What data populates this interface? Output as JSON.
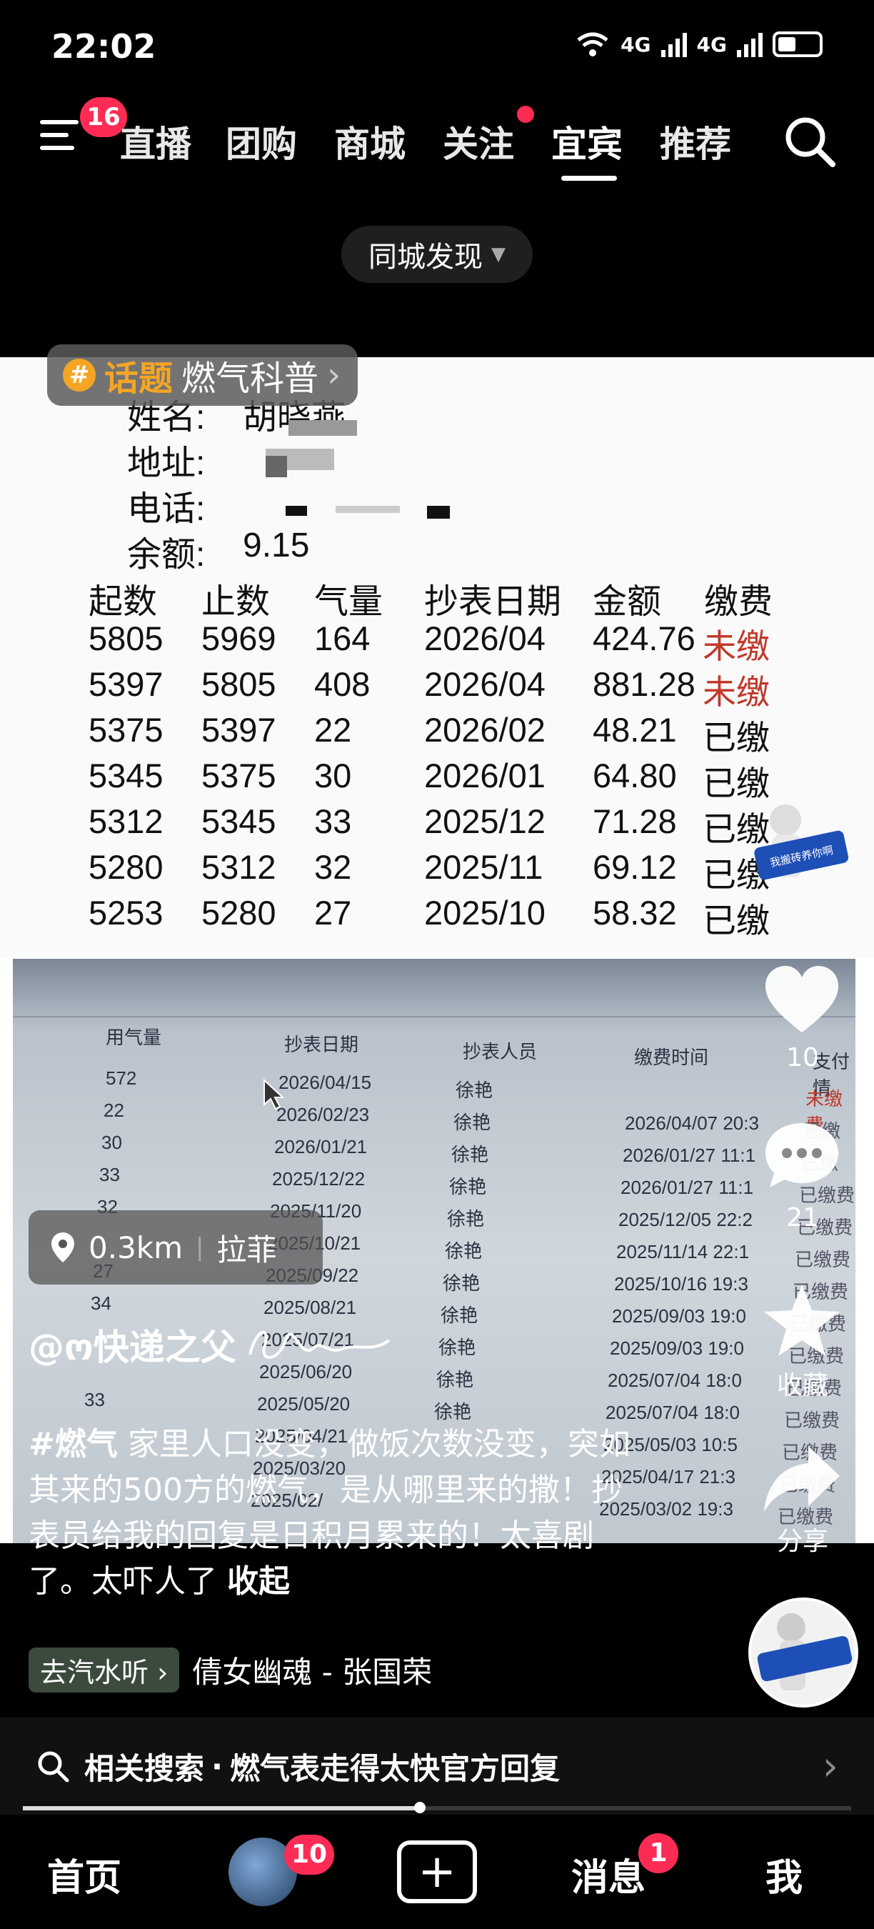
{
  "status_bar": {
    "time": "22:02",
    "network_1": "4G",
    "network_2": "4G"
  },
  "top_nav": {
    "menu_badge": "16",
    "tabs": [
      {
        "label": "直播",
        "active": false
      },
      {
        "label": "团购",
        "active": false
      },
      {
        "label": "商城",
        "active": false
      },
      {
        "label": "关注",
        "active": false,
        "dot": true
      },
      {
        "label": "宜宾",
        "active": true
      },
      {
        "label": "推荐",
        "active": false
      }
    ],
    "city_filter": "同城发现"
  },
  "topic": {
    "label": "话题",
    "name": "燃气科普"
  },
  "bill": {
    "name_label": "姓名:",
    "name_value": "胡晓燕",
    "address_label": "地址:",
    "phone_label": "电话:",
    "balance_label": "余额:",
    "balance_value": "9.15",
    "headers": [
      "起数",
      "止数",
      "气量",
      "抄表日期",
      "金额",
      "缴费"
    ],
    "rows": [
      [
        "5805",
        "5969",
        "164",
        "2026/04",
        "424.76",
        "未缴"
      ],
      [
        "5397",
        "5805",
        "408",
        "2026/04",
        "881.28",
        "未缴"
      ],
      [
        "5375",
        "5397",
        "22",
        "2026/02",
        "48.21",
        "已缴"
      ],
      [
        "5345",
        "5375",
        "30",
        "2026/01",
        "64.80",
        "已缴"
      ],
      [
        "5312",
        "5345",
        "33",
        "2025/12",
        "71.28",
        "已缴"
      ],
      [
        "5280",
        "5312",
        "32",
        "2025/11",
        "69.12",
        "已缴"
      ],
      [
        "5253",
        "5280",
        "27",
        "2025/10",
        "58.32",
        "已缴"
      ]
    ]
  },
  "screen_table": {
    "headers": [
      "用气量",
      "抄表日期",
      "抄表人员",
      "缴费时间",
      "支付情"
    ],
    "rows": [
      [
        "572",
        "2026/04/15",
        "徐艳",
        "",
        "未缴费"
      ],
      [
        "22",
        "2026/02/23",
        "徐艳",
        "2026/04/07 20:3",
        "已缴"
      ],
      [
        "30",
        "2026/01/21",
        "徐艳",
        "2026/01/27 11:1",
        "已缴"
      ],
      [
        "33",
        "2025/12/22",
        "徐艳",
        "2026/01/27 11:1",
        "已缴费"
      ],
      [
        "32",
        "2025/11/20",
        "徐艳",
        "2025/12/05 22:2",
        "已缴费"
      ],
      [
        "",
        "2025/10/21",
        "徐艳",
        "2025/11/14 22:1",
        "已缴费"
      ],
      [
        "27",
        "2025/09/22",
        "徐艳",
        "2025/10/16 19:3",
        "已缴费"
      ],
      [
        "34",
        "2025/08/21",
        "徐艳",
        "2025/09/03 19:0",
        "已缴费"
      ],
      [
        "",
        "2025/07/21",
        "徐艳",
        "2025/09/03 19:0",
        "已缴费"
      ],
      [
        "",
        "2025/06/20",
        "徐艳",
        "2025/07/04 18:0",
        "已缴费"
      ],
      [
        "33",
        "2025/05/20",
        "徐艳",
        "2025/07/04 18:0",
        "已缴费"
      ],
      [
        "",
        "2025/04/21",
        "",
        "2025/05/03 10:5",
        "已缴费"
      ],
      [
        "",
        "2025/03/20",
        "",
        "2025/04/17 21:3",
        "已缴费"
      ],
      [
        "",
        "2025/02/",
        "",
        "2025/03/02 19:3",
        "已缴费"
      ]
    ]
  },
  "location": {
    "distance": "0.3km",
    "place": "拉菲"
  },
  "author": "@ო快递之父",
  "caption": {
    "hashtag": "#燃气",
    "text": " 家里人口没变，做饭次数没变，突如其来的500方的燃气，是从哪里来的撒！抄表员给我的回复是日积月累来的！太喜剧了。太吓人了 ",
    "collapse": "收起"
  },
  "music": {
    "tag": "去汽水听",
    "title": "倩女幽魂 - 张国荣"
  },
  "rail": {
    "likes": "10",
    "comments": "21",
    "favorite": "收藏",
    "share": "分享",
    "sticker_text": "我搬砖养你啊"
  },
  "related": {
    "prefix": "相关搜索",
    "query": "燃气表走得太快官方回复"
  },
  "bottom_nav": {
    "home": "首页",
    "friends_badge": "10",
    "messages": "消息",
    "messages_badge": "1",
    "me": "我"
  }
}
